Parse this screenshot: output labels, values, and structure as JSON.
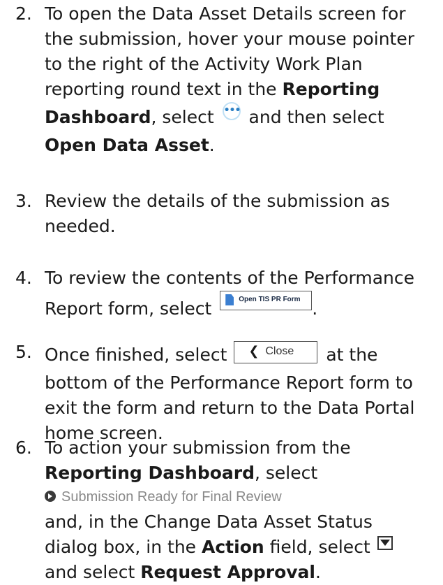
{
  "steps": [
    {
      "number": "2.",
      "lines": {
        "l1": "To open the Data Asset Details screen for",
        "l2": "the submission, hover your mouse pointer",
        "l3": "to the right of the Activity Work Plan",
        "l4_pre": "reporting round text in the ",
        "l4_bold": "Reporting",
        "l5_bold": "Dashboard",
        "l5_mid": ", select ",
        "l5_post": " and then select",
        "l6_bold": "Open Data Asset",
        "l6_post": "."
      },
      "icon": "more-options-icon"
    },
    {
      "number": "3.",
      "lines": {
        "l1": "Review the details of the submission as",
        "l2": "needed."
      }
    },
    {
      "number": "4.",
      "lines": {
        "l1": "To review the contents of the Performance",
        "l2_pre": "Report form, select ",
        "l2_post": "."
      },
      "button_label": "Open TIS PR Form",
      "icon": "document-icon"
    },
    {
      "number": "5.",
      "lines": {
        "l1_pre": "Once finished, select ",
        "l1_post": " at the",
        "l2": "bottom of the Performance Report form to",
        "l3": "exit the form and return to the Data Portal",
        "l4": "home screen."
      },
      "button_label": "Close",
      "icon": "chevron-left-icon"
    },
    {
      "number": "6.",
      "lines": {
        "l1": "To action your submission from the",
        "l2_bold": "Reporting Dashboard",
        "l2_post": ", select",
        "status_link": "Submission Ready for Final Review",
        "l3": "and, in the Change Data Asset Status",
        "l4_pre": "dialog box, in the ",
        "l4_bold": "Action",
        "l4_post": " field, select ",
        "l5_pre": "and select ",
        "l5_bold": "Request Approval",
        "l5_post": "."
      },
      "icons": [
        "circle-arrow-right-icon",
        "dropdown-arrow-icon"
      ]
    }
  ],
  "colors": {
    "text": "#1a1a1a",
    "status_link": "#8a8a8a",
    "accent_blue": "#3b7fd1"
  }
}
